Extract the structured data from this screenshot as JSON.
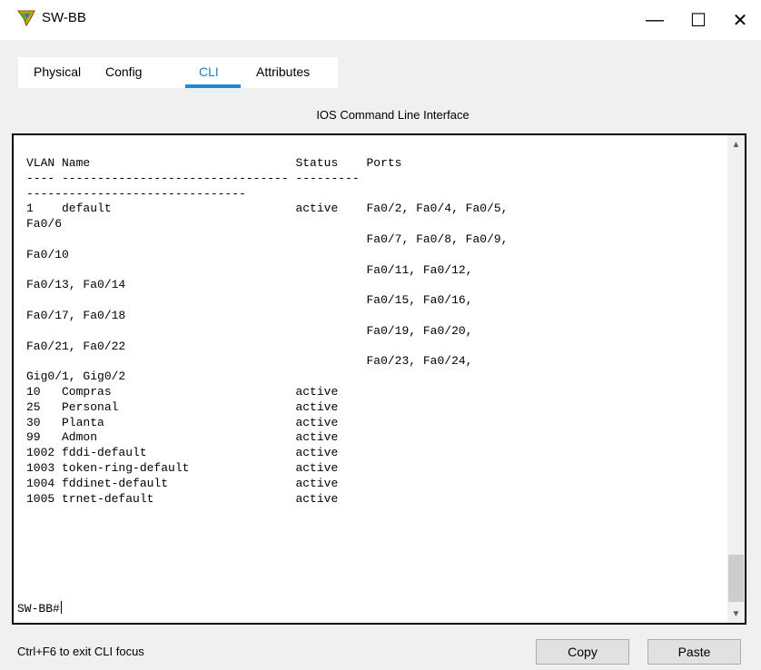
{
  "window": {
    "title": "SW-BB",
    "minimize_glyph": "—",
    "maximize_glyph": "☐",
    "close_glyph": "✕",
    "icon": "switch-icon"
  },
  "tabs": [
    {
      "label": "Physical",
      "active": false
    },
    {
      "label": "Config",
      "active": false
    },
    {
      "label": "CLI",
      "active": true
    },
    {
      "label": "Attributes",
      "active": false
    }
  ],
  "panel": {
    "title": "IOS Command Line Interface"
  },
  "terminal": {
    "lines": [
      "VLAN Name                             Status    Ports",
      "---- -------------------------------- ---------",
      "-------------------------------",
      "1    default                          active    Fa0/2, Fa0/4, Fa0/5,",
      "Fa0/6",
      "                                                Fa0/7, Fa0/8, Fa0/9,",
      "Fa0/10",
      "                                                Fa0/11, Fa0/12,",
      "Fa0/13, Fa0/14",
      "                                                Fa0/15, Fa0/16,",
      "Fa0/17, Fa0/18",
      "                                                Fa0/19, Fa0/20,",
      "Fa0/21, Fa0/22",
      "                                                Fa0/23, Fa0/24,",
      "Gig0/1, Gig0/2",
      "10   Compras                          active",
      "25   Personal                         active",
      "30   Planta                           active",
      "99   Admon                            active",
      "1002 fddi-default                     active",
      "1003 token-ring-default               active",
      "1004 fddinet-default                  active",
      "1005 trnet-default                    active"
    ],
    "prompt": "SW-BB#"
  },
  "footer": {
    "status": "Ctrl+F6 to exit CLI focus",
    "copy_label": "Copy",
    "paste_label": "Paste"
  },
  "colors": {
    "active_tab": "#1a7fd0",
    "tab_underline": "#1e8ad6"
  }
}
